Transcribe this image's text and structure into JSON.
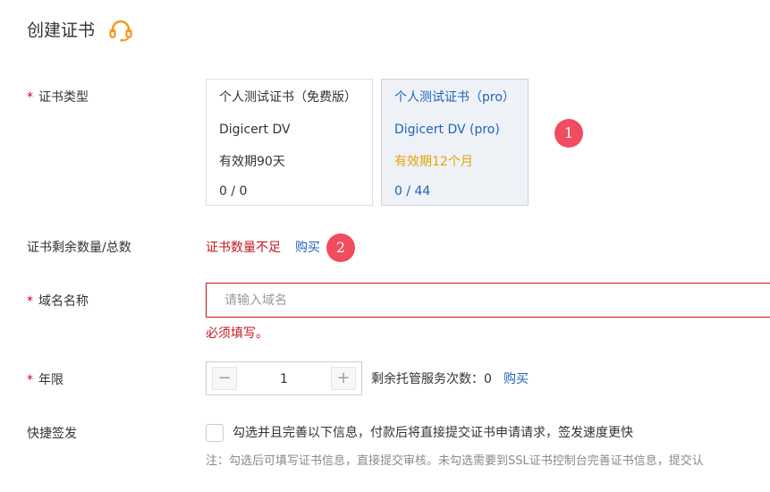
{
  "page": {
    "title": "创建证书",
    "support_icon": "headset-icon"
  },
  "form": {
    "cert_type": {
      "label": "证书类型",
      "required_mark": "*",
      "options": [
        {
          "name": "个人测试证书（免费版）",
          "brand": "Digicert DV",
          "validity": "有效期90天",
          "count": "0 / 0",
          "selected": false
        },
        {
          "name": "个人测试证书（pro）",
          "brand": "Digicert DV (pro)",
          "validity": "有效期12个月",
          "count": "0 / 44",
          "selected": true
        }
      ]
    },
    "remaining": {
      "label": "证书剩余数量/总数",
      "error": "证书数量不足",
      "buy_link": "购买"
    },
    "domain": {
      "label": "域名名称",
      "required_mark": "*",
      "placeholder": "请输入域名",
      "value": "",
      "error": "必须填写。"
    },
    "years": {
      "label": "年限",
      "required_mark": "*",
      "value": "1",
      "minus": "−",
      "plus": "+",
      "hosting_text": "剩余托管服务次数：0",
      "buy_link": "购买"
    },
    "quick_issue": {
      "label": "快捷签发",
      "checked": false,
      "text": "勾选并且完善以下信息，付款后将直接提交证书申请请求，签发速度更快",
      "note": "注：勾选后可填写证书信息，直接提交审核。未勾选需要到SSL证书控制台完善证书信息，提交认"
    }
  },
  "annotations": {
    "badge_1": "1",
    "badge_2": "2"
  },
  "colors": {
    "accent": "#1f64b8",
    "error": "#c4161c",
    "warning": "#e8a200",
    "badge": "#f14c5f",
    "icon": "#f39a1e"
  }
}
